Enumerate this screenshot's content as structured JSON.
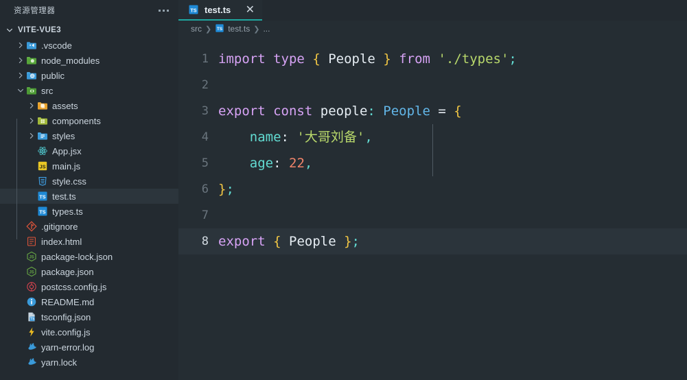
{
  "sidebar": {
    "title": "资源管理器",
    "more_label": "···",
    "root": {
      "label": "VITE-VUE3",
      "expanded": true
    },
    "items": [
      {
        "label": ".vscode",
        "type": "folder",
        "icon": "folder-vscode-icon",
        "depth": 1,
        "expanded": false,
        "arrow": true
      },
      {
        "label": "node_modules",
        "type": "folder",
        "icon": "folder-node-icon",
        "depth": 1,
        "expanded": false,
        "arrow": true
      },
      {
        "label": "public",
        "type": "folder",
        "icon": "folder-public-icon",
        "depth": 1,
        "expanded": false,
        "arrow": true
      },
      {
        "label": "src",
        "type": "folder",
        "icon": "folder-src-icon",
        "depth": 1,
        "expanded": true,
        "arrow": true
      },
      {
        "label": "assets",
        "type": "folder",
        "icon": "folder-assets-icon",
        "depth": 2,
        "expanded": false,
        "arrow": true
      },
      {
        "label": "components",
        "type": "folder",
        "icon": "folder-components-icon",
        "depth": 2,
        "expanded": false,
        "arrow": true
      },
      {
        "label": "styles",
        "type": "folder",
        "icon": "folder-styles-icon",
        "depth": 2,
        "expanded": false,
        "arrow": true
      },
      {
        "label": "App.jsx",
        "type": "file",
        "icon": "react-icon",
        "depth": 2,
        "arrow": false
      },
      {
        "label": "main.js",
        "type": "file",
        "icon": "javascript-icon",
        "depth": 2,
        "arrow": false
      },
      {
        "label": "style.css",
        "type": "file",
        "icon": "css-icon",
        "depth": 2,
        "arrow": false
      },
      {
        "label": "test.ts",
        "type": "file",
        "icon": "typescript-icon",
        "depth": 2,
        "arrow": false,
        "selected": true
      },
      {
        "label": "types.ts",
        "type": "file",
        "icon": "typescript-icon",
        "depth": 2,
        "arrow": false
      },
      {
        "label": ".gitignore",
        "type": "file",
        "icon": "git-icon",
        "depth": 1,
        "arrow": false
      },
      {
        "label": "index.html",
        "type": "file",
        "icon": "html-icon",
        "depth": 1,
        "arrow": false
      },
      {
        "label": "package-lock.json",
        "type": "file",
        "icon": "nodejs-json-icon",
        "depth": 1,
        "arrow": false
      },
      {
        "label": "package.json",
        "type": "file",
        "icon": "nodejs-json-icon",
        "depth": 1,
        "arrow": false
      },
      {
        "label": "postcss.config.js",
        "type": "file",
        "icon": "postcss-icon",
        "depth": 1,
        "arrow": false
      },
      {
        "label": "README.md",
        "type": "file",
        "icon": "info-readme-icon",
        "depth": 1,
        "arrow": false
      },
      {
        "label": "tsconfig.json",
        "type": "file",
        "icon": "tsconfig-icon",
        "depth": 1,
        "arrow": false
      },
      {
        "label": "vite.config.js",
        "type": "file",
        "icon": "vite-lightning-icon",
        "depth": 1,
        "arrow": false
      },
      {
        "label": "yarn-error.log",
        "type": "file",
        "icon": "yarn-icon",
        "depth": 1,
        "arrow": false
      },
      {
        "label": "yarn.lock",
        "type": "file",
        "icon": "yarn-icon",
        "depth": 1,
        "arrow": false
      }
    ]
  },
  "tabs": [
    {
      "label": "test.ts",
      "icon": "typescript-icon",
      "active": true,
      "close_glyph": "✕"
    }
  ],
  "breadcrumb": {
    "parts": [
      "src",
      "test.ts",
      "..."
    ],
    "separator": "❯"
  },
  "editor": {
    "language": "typescript",
    "active_line": 8,
    "lines": [
      {
        "n": 1,
        "tokens": [
          {
            "t": "import",
            "c": "kw"
          },
          {
            "t": " ",
            "c": "op"
          },
          {
            "t": "type",
            "c": "kw"
          },
          {
            "t": " ",
            "c": "op"
          },
          {
            "t": "{",
            "c": "brace"
          },
          {
            "t": " ",
            "c": "op"
          },
          {
            "t": "People",
            "c": "var"
          },
          {
            "t": " ",
            "c": "op"
          },
          {
            "t": "}",
            "c": "brace"
          },
          {
            "t": " ",
            "c": "op"
          },
          {
            "t": "from",
            "c": "kw"
          },
          {
            "t": " ",
            "c": "op"
          },
          {
            "t": "'./types'",
            "c": "str"
          },
          {
            "t": ";",
            "c": "punct"
          }
        ]
      },
      {
        "n": 2,
        "tokens": []
      },
      {
        "n": 3,
        "tokens": [
          {
            "t": "export",
            "c": "kw"
          },
          {
            "t": " ",
            "c": "op"
          },
          {
            "t": "const",
            "c": "kw"
          },
          {
            "t": " ",
            "c": "op"
          },
          {
            "t": "people",
            "c": "var"
          },
          {
            "t": ":",
            "c": "punct"
          },
          {
            "t": " ",
            "c": "op"
          },
          {
            "t": "People",
            "c": "type"
          },
          {
            "t": " ",
            "c": "op"
          },
          {
            "t": "=",
            "c": "op"
          },
          {
            "t": " ",
            "c": "op"
          },
          {
            "t": "{",
            "c": "brace"
          }
        ]
      },
      {
        "n": 4,
        "tokens": [
          {
            "t": "    ",
            "c": "op"
          },
          {
            "t": "name",
            "c": "prop"
          },
          {
            "t": ":",
            "c": "op"
          },
          {
            "t": " ",
            "c": "op"
          },
          {
            "t": "'大哥刘备'",
            "c": "cn"
          },
          {
            "t": ",",
            "c": "punct"
          }
        ]
      },
      {
        "n": 5,
        "tokens": [
          {
            "t": "    ",
            "c": "op"
          },
          {
            "t": "age",
            "c": "prop"
          },
          {
            "t": ":",
            "c": "op"
          },
          {
            "t": " ",
            "c": "op"
          },
          {
            "t": "22",
            "c": "num"
          },
          {
            "t": ",",
            "c": "punct"
          }
        ]
      },
      {
        "n": 6,
        "tokens": [
          {
            "t": "}",
            "c": "brace"
          },
          {
            "t": ";",
            "c": "punct"
          }
        ]
      },
      {
        "n": 7,
        "tokens": []
      },
      {
        "n": 8,
        "tokens": [
          {
            "t": "export",
            "c": "kw"
          },
          {
            "t": " ",
            "c": "op"
          },
          {
            "t": "{",
            "c": "brace"
          },
          {
            "t": " ",
            "c": "op"
          },
          {
            "t": "People",
            "c": "var"
          },
          {
            "t": " ",
            "c": "op"
          },
          {
            "t": "}",
            "c": "brace"
          },
          {
            "t": ";",
            "c": "punct"
          }
        ]
      }
    ],
    "plain_text": "import type { People } from './types';\n\nexport const people: People = {\n    name: '大哥刘备',\n    age: 22,\n};\n\nexport { People };"
  },
  "colors": {
    "sidebar_bg": "#232a30",
    "editor_bg": "#252d33",
    "active_line_bg": "#2b343b",
    "selected_row_bg": "#2c353c",
    "tab_accent": "#1fa7a0",
    "keyword": "#d7a3f5",
    "type": "#62b6e8",
    "string": "#b8d86b",
    "number": "#f0846a",
    "brace": "#f2c744",
    "property": "#62dbd2",
    "text": "#e6edf3",
    "line_number": "#6a757e"
  }
}
